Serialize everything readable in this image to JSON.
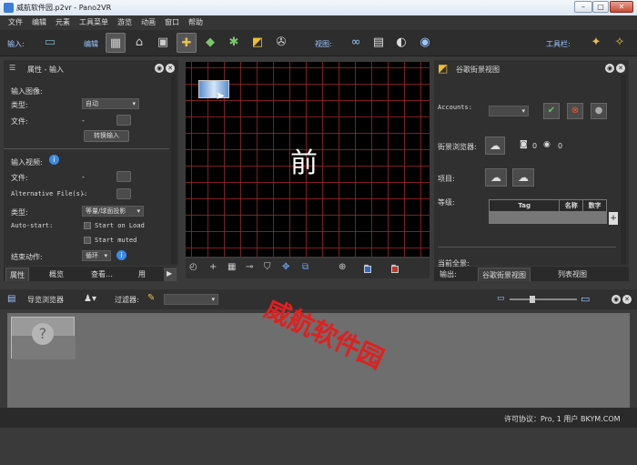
{
  "window": {
    "title": "威航软件园.p2vr - Pano2VR",
    "minimize": "–",
    "maximize": "□",
    "close": "✕"
  },
  "menu": [
    "文件",
    "编辑",
    "元素",
    "工具菜单",
    "游览",
    "动画",
    "窗口",
    "帮助"
  ],
  "toolbar": {
    "input_label": "输入:",
    "edit_label": "编辑",
    "view_label": "视图:",
    "tools_label": "工具栏:"
  },
  "props_panel": {
    "title": "属性 - 输入",
    "input_image_header": "输入图像:",
    "type_label": "类型:",
    "type_value": "自动",
    "file_label": "文件:",
    "file_value": "-",
    "convert_button": "转换输入",
    "input_video_header": "输入视频:",
    "video_file_label": "文件:",
    "video_file_value": "-",
    "alt_files_label": "Alternative File(s):",
    "alt_files_value": "-",
    "video_type_label": "类型:",
    "video_type_value": "等量/球面投影",
    "autostart_label": "Auto-start:",
    "start_on_load": "Start on Load",
    "start_muted": "Start muted",
    "end_action_label": "结束动作:",
    "end_action_value": "循环"
  },
  "left_tabs": [
    "属性",
    "概览",
    "查看…",
    "用"
  ],
  "viewer": {
    "center_text": "前"
  },
  "streetview_panel": {
    "title": "谷歌街景视图",
    "accounts_label": "Accounts:",
    "browser_label": "街景浏览器:",
    "camera_count": "0",
    "view_count": "0",
    "project_label": "项目:",
    "level_label": "等级:",
    "table_headers": [
      "Tag",
      "名称",
      "数字"
    ],
    "add_row": "+",
    "current_pano_label": "当前全景:"
  },
  "right_tabs": [
    "输出:",
    "谷歌街景视图",
    "列表视图"
  ],
  "browser_bar": {
    "title": "导览浏览器",
    "filter_label": "过滤器:"
  },
  "status": {
    "license": "许可协议：Pro, 1 用户 BKYM.COM"
  },
  "watermark": "威航软件园",
  "colors": {
    "accent_blue": "#9cc8ff",
    "grid_red": "#a82828",
    "watermark_red": "#e0201f"
  }
}
